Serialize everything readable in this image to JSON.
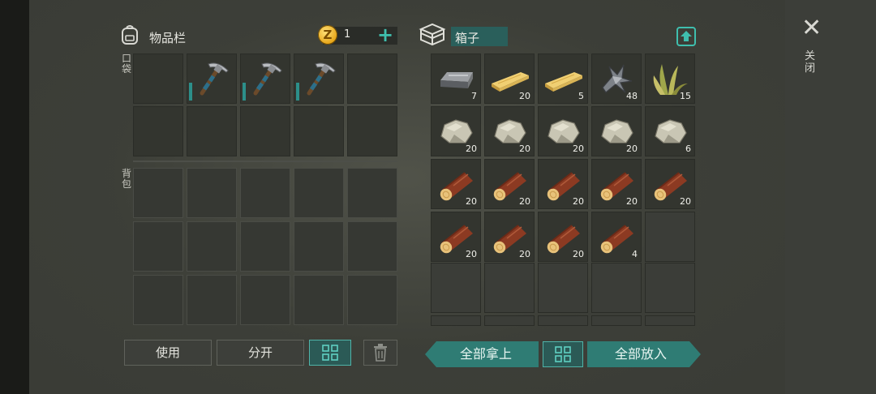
{
  "inventory": {
    "title": "物品栏",
    "coins": "1",
    "pocket_label": "口袋",
    "backpack_label": "背包",
    "pocket_items": [
      "pickaxe",
      "pickaxe",
      "pickaxe"
    ]
  },
  "chest": {
    "title": "箱子",
    "items": [
      {
        "item": "iron-bar-icon",
        "count": "7"
      },
      {
        "item": "plank-icon",
        "count": "20"
      },
      {
        "item": "plank-icon",
        "count": "5"
      },
      {
        "item": "scrap-metal-icon",
        "count": "48"
      },
      {
        "item": "plant-fiber-icon",
        "count": "15"
      },
      {
        "item": "stone-icon",
        "count": "20"
      },
      {
        "item": "stone-icon",
        "count": "20"
      },
      {
        "item": "stone-icon",
        "count": "20"
      },
      {
        "item": "stone-icon",
        "count": "20"
      },
      {
        "item": "stone-icon",
        "count": "6"
      },
      {
        "item": "log-icon",
        "count": "20"
      },
      {
        "item": "log-icon",
        "count": "20"
      },
      {
        "item": "log-icon",
        "count": "20"
      },
      {
        "item": "log-icon",
        "count": "20"
      },
      {
        "item": "log-icon",
        "count": "20"
      },
      {
        "item": "log-icon",
        "count": "20"
      },
      {
        "item": "log-icon",
        "count": "20"
      },
      {
        "item": "log-icon",
        "count": "20"
      },
      {
        "item": "log-icon",
        "count": "4"
      }
    ]
  },
  "buttons": {
    "use": "使用",
    "split": "分开",
    "take_all": "全部拿上",
    "put_all": "全部放入"
  },
  "close_label": "关闭",
  "colors": {
    "accent_teal": "#3fbfae",
    "arrow_button": "#2f7c74",
    "durability": "#2c8f8a"
  }
}
